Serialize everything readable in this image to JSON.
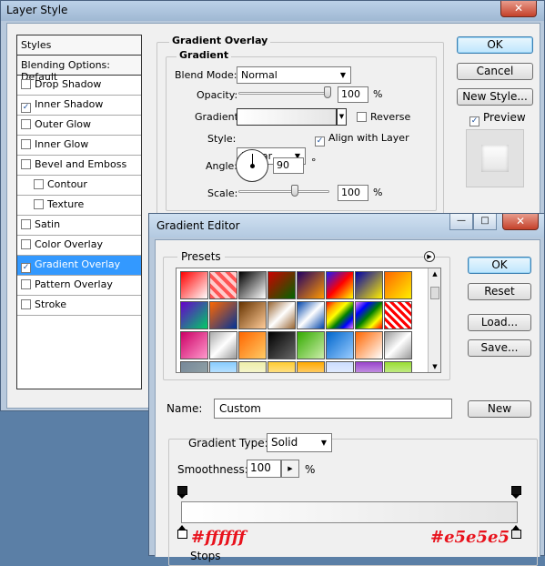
{
  "layer_style": {
    "title": "Layer Style",
    "close_glyph": "✕",
    "styles_header": "Styles",
    "blending_options": "Blending Options: Default",
    "items": [
      {
        "label": "Drop Shadow",
        "checked": false,
        "sub": false
      },
      {
        "label": "Inner Shadow",
        "checked": true,
        "sub": false
      },
      {
        "label": "Outer Glow",
        "checked": false,
        "sub": false
      },
      {
        "label": "Inner Glow",
        "checked": false,
        "sub": false
      },
      {
        "label": "Bevel and Emboss",
        "checked": false,
        "sub": false
      },
      {
        "label": "Contour",
        "checked": false,
        "sub": true
      },
      {
        "label": "Texture",
        "checked": false,
        "sub": true
      },
      {
        "label": "Satin",
        "checked": false,
        "sub": false
      },
      {
        "label": "Color Overlay",
        "checked": false,
        "sub": false
      },
      {
        "label": "Gradient Overlay",
        "checked": true,
        "sub": false,
        "selected": true
      },
      {
        "label": "Pattern Overlay",
        "checked": false,
        "sub": false
      },
      {
        "label": "Stroke",
        "checked": false,
        "sub": false
      }
    ],
    "section_title": "Gradient Overlay",
    "group_title": "Gradient",
    "blend_mode_label": "Blend Mode:",
    "blend_mode_value": "Normal",
    "opacity_label": "Opacity:",
    "opacity_value": "100",
    "opacity_unit": "%",
    "opacity_level": 100,
    "gradient_label": "Gradient:",
    "reverse_label": "Reverse",
    "style_label": "Style:",
    "style_value": "Linear",
    "align_label": "Align with Layer",
    "angle_label": "Angle:",
    "angle_value": "90",
    "angle_unit": "°",
    "scale_label": "Scale:",
    "scale_value": "100",
    "scale_unit": "%",
    "scale_level": 100,
    "ok": "OK",
    "cancel": "Cancel",
    "new_style": "New Style...",
    "preview": "Preview"
  },
  "gradient_editor": {
    "title": "Gradient Editor",
    "minimize": "—",
    "maximize": "□",
    "close": "✕",
    "presets_label": "Presets",
    "ok": "OK",
    "reset": "Reset",
    "load": "Load...",
    "save": "Save...",
    "name_label": "Name:",
    "name_value": "Custom",
    "new_button": "New",
    "gradient_type_label": "Gradient Type:",
    "gradient_type_value": "Solid",
    "smoothness_label": "Smoothness:",
    "smoothness_value": "100",
    "smoothness_unit": "%",
    "stops_label": "Stops",
    "left_color": "#ffffff",
    "right_color": "#e5e5e5",
    "left_annotation": "#ffffff",
    "right_annotation": "#e5e5e5"
  }
}
